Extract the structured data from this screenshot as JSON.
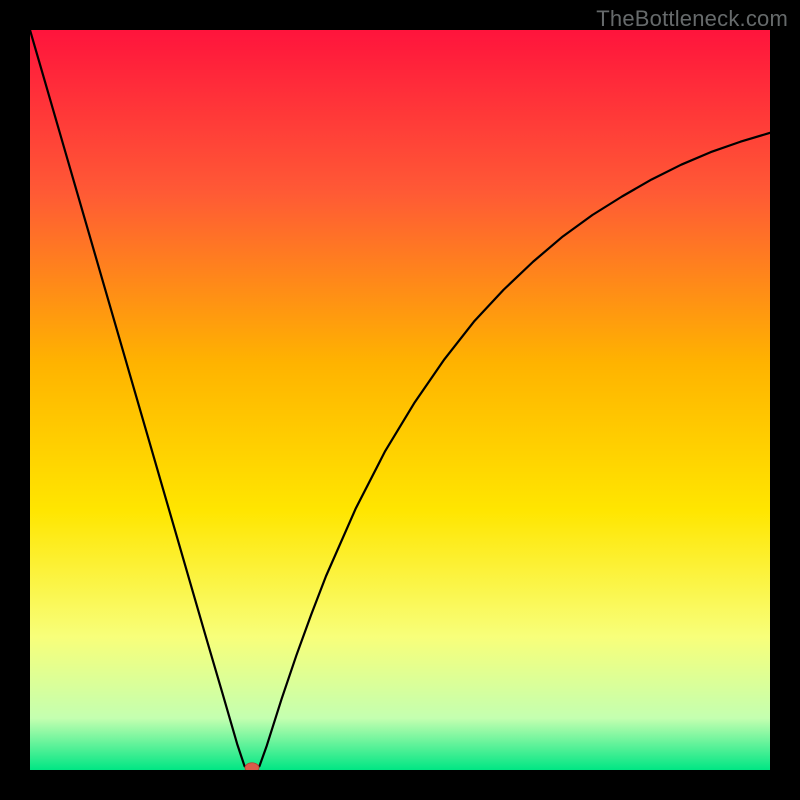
{
  "watermark": "TheBottleneck.com",
  "chart_data": {
    "type": "line",
    "title": "",
    "xlabel": "",
    "ylabel": "",
    "xlim": [
      0,
      100
    ],
    "ylim": [
      0,
      100
    ],
    "grid": false,
    "legend": false,
    "series": [
      {
        "name": "curve",
        "x": [
          0,
          2,
          4,
          6,
          8,
          10,
          12,
          14,
          16,
          18,
          20,
          22,
          24,
          26,
          28,
          29,
          30,
          31,
          32,
          34,
          36,
          38,
          40,
          44,
          48,
          52,
          56,
          60,
          64,
          68,
          72,
          76,
          80,
          84,
          88,
          92,
          96,
          100
        ],
        "y": [
          100,
          93.1,
          86.2,
          79.3,
          72.4,
          65.5,
          58.6,
          51.7,
          44.8,
          37.9,
          31.0,
          24.1,
          17.2,
          10.4,
          3.5,
          0.5,
          0.3,
          0.5,
          3.3,
          9.6,
          15.5,
          21.0,
          26.2,
          35.3,
          43.1,
          49.7,
          55.5,
          60.6,
          64.9,
          68.7,
          72.1,
          75.0,
          77.5,
          79.8,
          81.8,
          83.5,
          84.9,
          86.1
        ]
      }
    ],
    "marker": {
      "x": 30,
      "y": 0.3,
      "shape": "ellipse",
      "color": "#d95b4a"
    },
    "background": "rainbow-vertical-gradient",
    "gradient_stops": [
      {
        "pct": 0,
        "color": "#ff143c"
      },
      {
        "pct": 22,
        "color": "#ff5a35"
      },
      {
        "pct": 45,
        "color": "#ffb300"
      },
      {
        "pct": 65,
        "color": "#ffe600"
      },
      {
        "pct": 82,
        "color": "#f8ff7a"
      },
      {
        "pct": 93,
        "color": "#c4ffb0"
      },
      {
        "pct": 100,
        "color": "#00e684"
      }
    ]
  }
}
